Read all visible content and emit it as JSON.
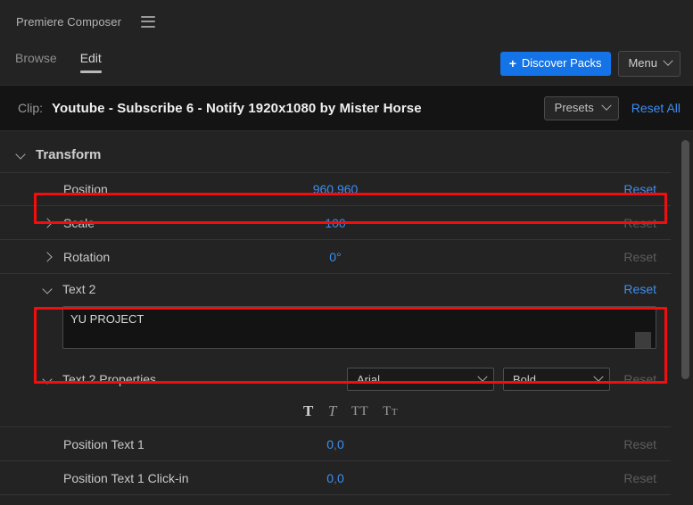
{
  "app": {
    "title": "Premiere Composer",
    "menu_icon": "hamburger-icon"
  },
  "tabs": [
    {
      "label": "Browse",
      "active": false
    },
    {
      "label": "Edit",
      "active": true
    }
  ],
  "top_actions": {
    "discover_plus": "+",
    "discover_label": "Discover Packs",
    "menu_label": "Menu",
    "chevron_icon": "chevron-down-icon"
  },
  "clip_bar": {
    "label": "Clip:",
    "name": "Youtube - Subscribe 6 - Notify 1920x1080 by Mister Horse",
    "presets_label": "Presets",
    "reset_all_label": "Reset All"
  },
  "sections": {
    "transform": {
      "title": "Transform",
      "expanded": true,
      "rows": [
        {
          "name": "Position",
          "value": "960",
          "value2": "960",
          "separator": ",",
          "reset": "Reset",
          "reset_active": true,
          "highlighted": true,
          "has_twisty": false
        },
        {
          "name": "Scale",
          "value": "100",
          "reset": "Reset",
          "reset_active": false,
          "highlighted": false,
          "has_twisty": true
        },
        {
          "name": "Rotation",
          "value": "0°",
          "reset": "Reset",
          "reset_active": false,
          "highlighted": false,
          "has_twisty": true
        }
      ]
    },
    "text2": {
      "title": "Text 2",
      "reset": "Reset",
      "expanded": true,
      "textarea_value": "YU PROJECT",
      "highlighted": true
    },
    "text2_properties": {
      "title": "Text 2 Properties",
      "expanded": true,
      "font_value": "Arial",
      "weight_value": "Bold",
      "reset": "Reset",
      "style_buttons": [
        {
          "icon": "bold-icon",
          "glyph": "T",
          "active": true
        },
        {
          "icon": "italic-icon",
          "glyph": "T",
          "active": false
        },
        {
          "icon": "all-caps-icon",
          "glyph": "TT",
          "active": false
        },
        {
          "icon": "small-caps-icon",
          "glyph": "T",
          "glyph_small": "T",
          "active": false
        }
      ]
    },
    "bottom_rows": [
      {
        "name": "Position Text 1",
        "value": "0",
        "value2": "0",
        "separator": ",",
        "reset": "Reset",
        "reset_active": false
      },
      {
        "name": "Position Text 1 Click-in",
        "value": "0",
        "value2": "0",
        "separator": ",",
        "reset": "Reset",
        "reset_active": false
      }
    ]
  },
  "colors": {
    "accent_blue": "#3c8ef0",
    "button_blue": "#1473e6",
    "highlight_red": "#f40d0d",
    "background": "#232323"
  }
}
